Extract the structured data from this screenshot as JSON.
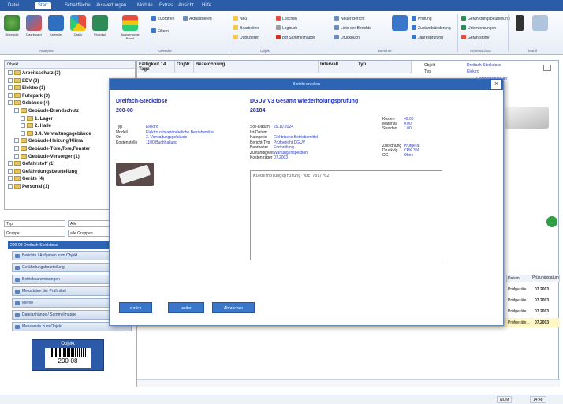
{
  "menu": [
    "Datei",
    "Start",
    "Schaltfläche",
    "Auswertungen",
    "Module",
    "Extras",
    "Ansicht",
    "Hilfe"
  ],
  "ribbon": {
    "big_buttons": [
      "Übersicht",
      "Dashboard",
      "Kalender",
      "Grafik",
      "Protokoll",
      "Auswertungs Board"
    ],
    "small_a": [
      "Zuordnen",
      "Filtern",
      "Aktualisieren"
    ],
    "small_b": [
      "Neu",
      "Bearbeiten",
      "Duplizieren"
    ],
    "small_c": [
      "Löschen",
      "Logbuch",
      "pdf Sammelmappe"
    ],
    "small_d": [
      "Neuer Bericht",
      "Liste der Berichte",
      "Druckbuch"
    ],
    "small_e": [
      "Prüfung",
      "Zustandsänderung",
      "Jahresprüfung"
    ],
    "side_a": [
      "Gefährdungsbeurteilung",
      "Unterweisungen"
    ],
    "side_b": "Gefahrstoffe",
    "groups": [
      "Analysen",
      "Kalender",
      "Objekt",
      "Berichte",
      "Arbeitsschutz",
      "Mobil"
    ]
  },
  "tree": {
    "header": "Objekt",
    "nodes": [
      {
        "label": "Arbeitsschutz (3)",
        "level": 0
      },
      {
        "label": "EDV (8)",
        "level": 0
      },
      {
        "label": "Elektro (1)",
        "level": 0
      },
      {
        "label": "Fuhrpark (3)",
        "level": 0
      },
      {
        "label": "Gebäude (4)",
        "level": 0
      },
      {
        "label": "Gebäude-Brandschutz",
        "level": 1
      },
      {
        "label": "1. Lager",
        "level": 2
      },
      {
        "label": "2. Halle",
        "level": 2
      },
      {
        "label": "3.4. Verwaltungsgebäude",
        "level": 2
      },
      {
        "label": "Gebäude-Heizung/Klima",
        "level": 1
      },
      {
        "label": "Gebäude-Türe,Tore,Fenster",
        "level": 1
      },
      {
        "label": "Gebäude-Versorger (1)",
        "level": 1
      },
      {
        "label": "Gefahrstoff (1)",
        "level": 0
      },
      {
        "label": "Gefährdungsbeurteilung",
        "level": 0
      },
      {
        "label": "Geräte (4)",
        "level": 0
      },
      {
        "label": "Personal (1)",
        "level": 0
      }
    ]
  },
  "filters": [
    "Typ",
    "Alle",
    "Gruppe",
    "alle Gruppen"
  ],
  "selected_object": "200-08 Dreifach-Steckdose",
  "side_buttons": [
    "Berichte / Aufgaben zum Objekt",
    "Gefährdungsbeurteilung",
    "Betriebsanweisungen",
    "Messdaten der Prüfmittel",
    "Memo",
    "Dateianhänge / Sammelmappe",
    "Messwerte zum Objekt"
  ],
  "label_card": {
    "title": "Objekt",
    "code": "200-08"
  },
  "grid": {
    "headers": [
      "Fälligkeit 14 Tage",
      "ObjNr",
      "Bezeichnung",
      "Intervall",
      "Typ"
    ],
    "right_panel": [
      "Objekt",
      "Typ",
      "Dreifach-Steckdose",
      "Elektro",
      "Geräteprüfung an Betriebsmitteln"
    ],
    "cols_right": [
      "Datum",
      "Prüfungsdatum"
    ],
    "rows": [
      [
        "Prüfgeräte...",
        "07.2003"
      ],
      [
        "Prüfgeräte...",
        "07.2003"
      ],
      [
        "Prüfgeräte...",
        "07.2003"
      ],
      [
        "Prüfgeräte...",
        "07.2003"
      ]
    ]
  },
  "dialog": {
    "title": "Bericht drucken",
    "left_title": "Dreifach-Steckdose",
    "left_code": "200-08",
    "left_fields": [
      {
        "k": "Typ",
        "v": "Elektro"
      },
      {
        "k": "Modell",
        "v": "Elektro ortsveränderliche Betriebsmittel"
      },
      {
        "k": "Ort",
        "v": "3. Verwaltungsgebäude"
      },
      {
        "k": "Kostenstelle",
        "v": "1100 Buchhaltung"
      }
    ],
    "right_title": "DGUV V3 Gesamt Wiederholungsprüfung",
    "right_code": "28184",
    "right_fields": [
      {
        "k": "Soll-Datum",
        "v": "29.10.2024"
      },
      {
        "k": "Ist-Datum",
        "v": ""
      },
      {
        "k": "Kategorie",
        "v": "Elektrische Betriebsmittel"
      },
      {
        "k": "Bericht-Typ",
        "v": "Prüfbericht DGUV"
      },
      {
        "k": "Bearbeiter",
        "v": "Erstprüfung"
      },
      {
        "k": "Zuständigkeit",
        "v": "Wartung/Inspektion"
      },
      {
        "k": "Kostenträger",
        "v": "07.2003"
      }
    ],
    "far_fields": [
      {
        "k": "Kosten",
        "v": "49.00"
      },
      {
        "k": "Material",
        "v": "0.00"
      },
      {
        "k": "Stunden",
        "v": "1.00"
      },
      {
        "k": "Zuordnung",
        "v": "Prüfgerät"
      },
      {
        "k": "Druckvlg.",
        "v": "CRK 356"
      },
      {
        "k": "OC",
        "v": "Ohne"
      }
    ],
    "memo": "Wiederholungsprüfung VDE 701/702",
    "buttons": [
      "zurück",
      "weiter",
      "Abbrechen"
    ]
  },
  "status": [
    "NUM",
    "14:48"
  ]
}
